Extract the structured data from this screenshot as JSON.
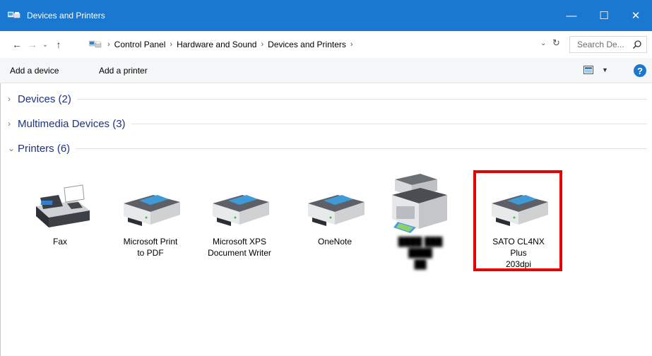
{
  "window": {
    "title": "Devices and Printers",
    "controls": {
      "minimize": "—",
      "maximize": "☐",
      "close": "✕"
    }
  },
  "addressbar": {
    "breadcrumb": [
      "Control Panel",
      "Hardware and Sound",
      "Devices and Printers"
    ],
    "search_placeholder": "Search De..."
  },
  "commandbar": {
    "add_device": "Add a device",
    "add_printer": "Add a printer",
    "help": "?"
  },
  "groups": [
    {
      "label": "Devices (2)",
      "expanded": false
    },
    {
      "label": "Multimedia Devices (3)",
      "expanded": false
    },
    {
      "label": "Printers (6)",
      "expanded": true
    }
  ],
  "printers": [
    {
      "line1": "Fax",
      "line2": "",
      "icon": "fax-icon"
    },
    {
      "line1": "Microsoft Print",
      "line2": "to PDF",
      "icon": "printer-icon"
    },
    {
      "line1": "Microsoft XPS",
      "line2": "Document Writer",
      "icon": "printer-icon"
    },
    {
      "line1": "OneNote",
      "line2": "",
      "icon": "printer-icon"
    },
    {
      "line1": "████ ███ ████",
      "line2": "██",
      "icon": "multifunction-printer-icon",
      "blurred": true
    },
    {
      "line1": "SATO CL4NX Plus",
      "line2": "203dpi",
      "icon": "printer-icon",
      "highlighted": true
    }
  ],
  "colors": {
    "titlebar": "#1b78d0",
    "group_label": "#1e3287",
    "highlight": "#e60000"
  }
}
